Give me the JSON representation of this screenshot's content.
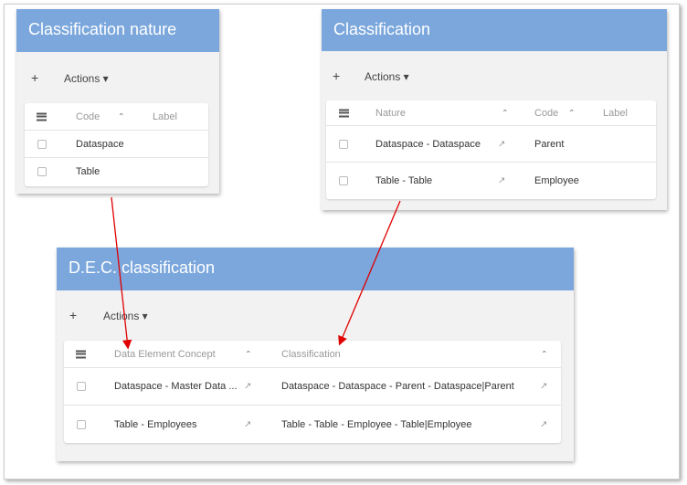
{
  "nature_panel": {
    "title": "Classification nature",
    "add": "+",
    "actions": "Actions ▾",
    "menu_icon": "hamburger-icon",
    "columns": [
      "Code",
      "Label"
    ],
    "sort_icon": "⌃",
    "rows": [
      {
        "code": "Dataspace",
        "label": ""
      },
      {
        "code": "Table",
        "label": ""
      }
    ]
  },
  "classification_panel": {
    "title": "Classification",
    "add": "+",
    "actions": "Actions ▾",
    "columns": [
      "Nature",
      "Code",
      "Label"
    ],
    "sort_icon": "⌃",
    "link_icon": "↗",
    "rows": [
      {
        "nature": "Dataspace - Dataspace",
        "code": "Parent",
        "label": ""
      },
      {
        "nature": "Table - Table",
        "code": "Employee",
        "label": ""
      }
    ]
  },
  "dec_panel": {
    "title": "D.E.C. classification",
    "add": "+",
    "actions": "Actions ▾",
    "columns": [
      "Data Element Concept",
      "Classification"
    ],
    "sort_icon": "⌃",
    "link_icon": "↗",
    "rows": [
      {
        "dec": "Dataspace - Master Data ...",
        "classification": "Dataspace - Dataspace - Parent - Dataspace|Parent"
      },
      {
        "dec": "Table - Employees",
        "classification": "Table - Table - Employee - Table|Employee"
      }
    ]
  },
  "colors": {
    "header": "#7ba7dc",
    "toolbar": "#f2f2f2",
    "arrow": "#e00000"
  }
}
